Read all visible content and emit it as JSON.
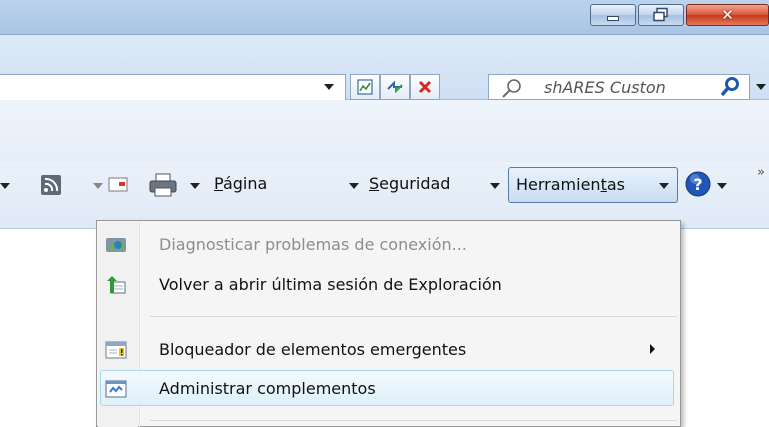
{
  "search": {
    "placeholder": "shARES Custon"
  },
  "command_bar": {
    "page_label": "Página",
    "page_accesskey": "P",
    "page_rest": "ágina",
    "security_label": "Seguridad",
    "security_accesskey": "S",
    "security_rest": "eguridad",
    "tools_pre": "Herramien",
    "tools_accesskey": "t",
    "tools_post": "as"
  },
  "menu": {
    "items": [
      {
        "label": "Diagnosticar problemas de conexión...",
        "enabled": false,
        "icon": "network-diagnose-icon"
      },
      {
        "label": "Volver a abrir última sesión de Exploración",
        "enabled": true,
        "icon": "reopen-session-icon"
      },
      {
        "label": "Bloqueador de elementos emergentes",
        "enabled": true,
        "icon": "popup-blocker-icon",
        "submenu": true
      },
      {
        "label": "Administrar complementos",
        "enabled": true,
        "icon": "manage-addons-icon",
        "highlighted": true
      }
    ]
  },
  "colors": {
    "titlebar": "#bcd3ec",
    "close_button": "#c7381c",
    "menu_highlight_border": "#a8d8eb",
    "disabled_text": "#8d8d8d"
  }
}
